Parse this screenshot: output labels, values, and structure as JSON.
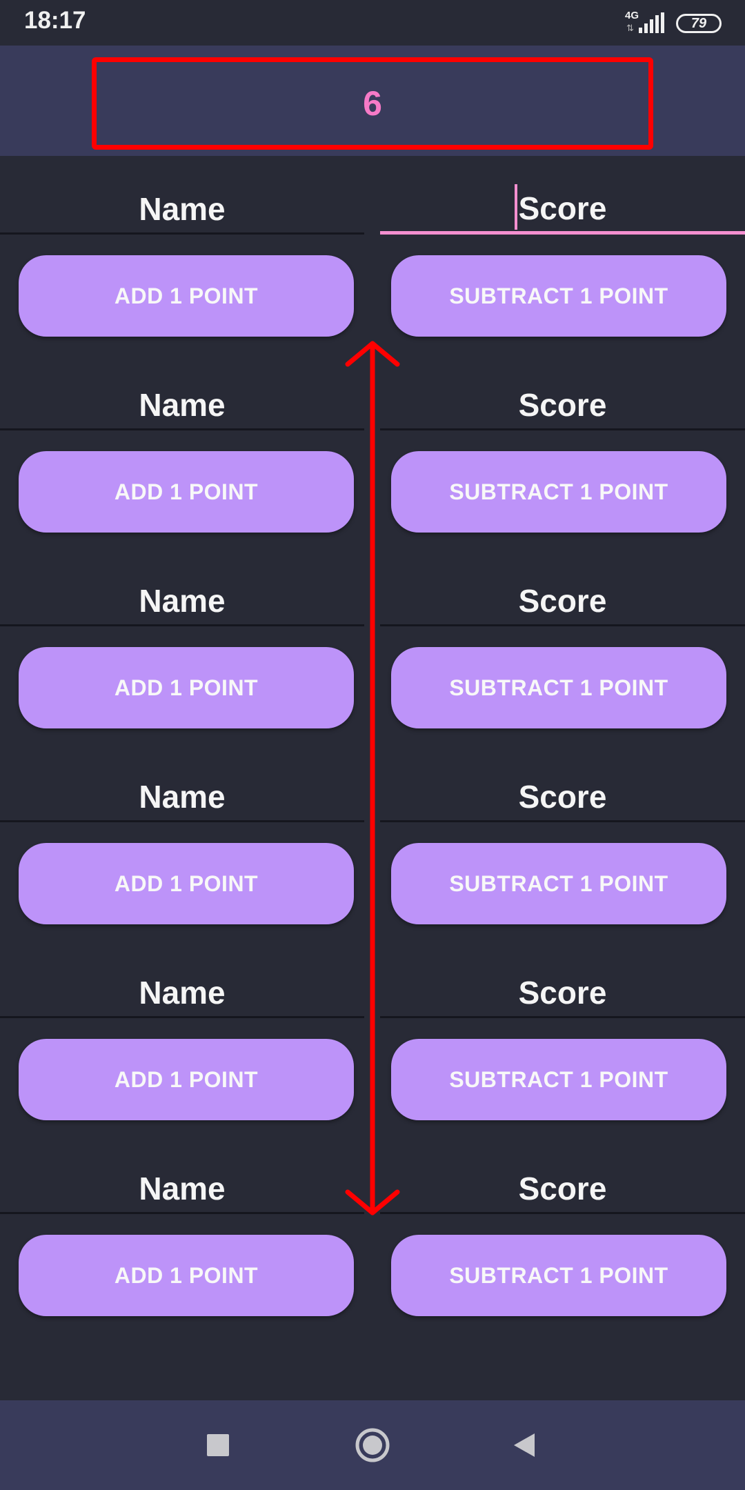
{
  "status_bar": {
    "time": "18:17",
    "network_type": "4G",
    "network_arrows": "⇅",
    "battery": "79"
  },
  "counter": {
    "value": "6"
  },
  "players": [
    {
      "name_placeholder": "Name",
      "score_placeholder": "Score",
      "add_label": "ADD 1 POINT",
      "subtract_label": "SUBTRACT 1 POINT",
      "score_focused": true
    },
    {
      "name_placeholder": "Name",
      "score_placeholder": "Score",
      "add_label": "ADD 1 POINT",
      "subtract_label": "SUBTRACT 1 POINT",
      "score_focused": false
    },
    {
      "name_placeholder": "Name",
      "score_placeholder": "Score",
      "add_label": "ADD 1 POINT",
      "subtract_label": "SUBTRACT 1 POINT",
      "score_focused": false
    },
    {
      "name_placeholder": "Name",
      "score_placeholder": "Score",
      "add_label": "ADD 1 POINT",
      "subtract_label": "SUBTRACT 1 POINT",
      "score_focused": false
    },
    {
      "name_placeholder": "Name",
      "score_placeholder": "Score",
      "add_label": "ADD 1 POINT",
      "subtract_label": "SUBTRACT 1 POINT",
      "score_focused": false
    },
    {
      "name_placeholder": "Name",
      "score_placeholder": "Score",
      "add_label": "ADD 1 POINT",
      "subtract_label": "SUBTRACT 1 POINT",
      "score_focused": false
    }
  ],
  "nav_bar": {
    "recents_icon": "square-icon",
    "home_icon": "circle-icon",
    "back_icon": "triangle-icon"
  },
  "colors": {
    "background": "#282a36",
    "header": "#393b5b",
    "button": "#bd93f9",
    "accent_pink": "#f48fd0",
    "annotation_red": "#ff0000"
  }
}
